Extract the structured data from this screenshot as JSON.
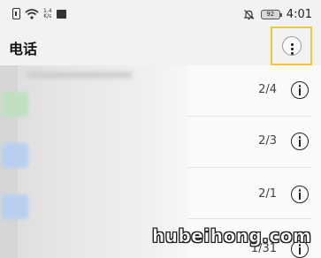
{
  "status_bar": {
    "net_speed_value": "1.4",
    "net_speed_unit": "K/s",
    "battery": "92",
    "time": "4:01"
  },
  "app_bar": {
    "title": "电话",
    "more_icon": "more-vertical-icon",
    "highlight_color": "#f0c63a"
  },
  "call_log": {
    "rows": [
      {
        "count": "2/4"
      },
      {
        "count": "2/3"
      },
      {
        "count": "2/1"
      },
      {
        "count": "1/31"
      }
    ]
  },
  "watermark": "hubeihong.com"
}
